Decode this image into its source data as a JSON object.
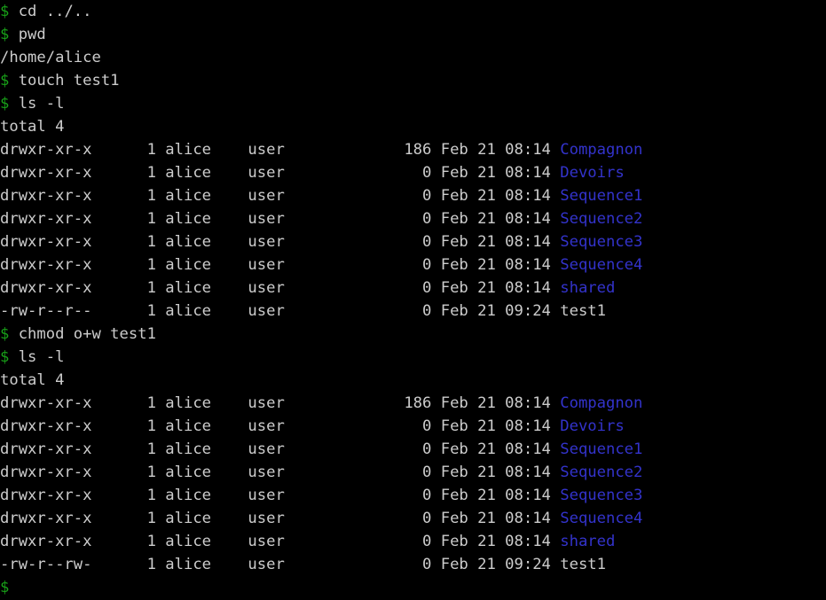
{
  "terminal": {
    "background_color": "#000000",
    "text_color": "#cccccc",
    "prompt_color": "#18a018",
    "directory_color": "#3333cc",
    "prompt_symbol": "$",
    "lines": [
      {
        "kind": "command",
        "prompt": "$",
        "text": " cd ../.."
      },
      {
        "kind": "command",
        "prompt": "$",
        "text": " pwd"
      },
      {
        "kind": "output",
        "text": "/home/alice"
      },
      {
        "kind": "command",
        "prompt": "$",
        "text": " touch test1"
      },
      {
        "kind": "command",
        "prompt": "$",
        "text": " ls -l"
      },
      {
        "kind": "output",
        "text": "total 4"
      },
      {
        "kind": "listing",
        "perms": "drwxr-xr-x",
        "links": "1",
        "owner": "alice",
        "group": "user",
        "size": "186",
        "month": "Feb",
        "day": "21",
        "time": "08:14",
        "name": "Compagnon",
        "nametype": "dir"
      },
      {
        "kind": "listing",
        "perms": "drwxr-xr-x",
        "links": "1",
        "owner": "alice",
        "group": "user",
        "size": "0",
        "month": "Feb",
        "day": "21",
        "time": "08:14",
        "name": "Devoirs",
        "nametype": "dir"
      },
      {
        "kind": "listing",
        "perms": "drwxr-xr-x",
        "links": "1",
        "owner": "alice",
        "group": "user",
        "size": "0",
        "month": "Feb",
        "day": "21",
        "time": "08:14",
        "name": "Sequence1",
        "nametype": "dir"
      },
      {
        "kind": "listing",
        "perms": "drwxr-xr-x",
        "links": "1",
        "owner": "alice",
        "group": "user",
        "size": "0",
        "month": "Feb",
        "day": "21",
        "time": "08:14",
        "name": "Sequence2",
        "nametype": "dir"
      },
      {
        "kind": "listing",
        "perms": "drwxr-xr-x",
        "links": "1",
        "owner": "alice",
        "group": "user",
        "size": "0",
        "month": "Feb",
        "day": "21",
        "time": "08:14",
        "name": "Sequence3",
        "nametype": "dir"
      },
      {
        "kind": "listing",
        "perms": "drwxr-xr-x",
        "links": "1",
        "owner": "alice",
        "group": "user",
        "size": "0",
        "month": "Feb",
        "day": "21",
        "time": "08:14",
        "name": "Sequence4",
        "nametype": "dir"
      },
      {
        "kind": "listing",
        "perms": "drwxr-xr-x",
        "links": "1",
        "owner": "alice",
        "group": "user",
        "size": "0",
        "month": "Feb",
        "day": "21",
        "time": "08:14",
        "name": "shared",
        "nametype": "dir"
      },
      {
        "kind": "listing",
        "perms": "-rw-r--r--",
        "links": "1",
        "owner": "alice",
        "group": "user",
        "size": "0",
        "month": "Feb",
        "day": "21",
        "time": "09:24",
        "name": "test1",
        "nametype": "file"
      },
      {
        "kind": "command",
        "prompt": "$",
        "text": " chmod o+w test1"
      },
      {
        "kind": "command",
        "prompt": "$",
        "text": " ls -l"
      },
      {
        "kind": "output",
        "text": "total 4"
      },
      {
        "kind": "listing",
        "perms": "drwxr-xr-x",
        "links": "1",
        "owner": "alice",
        "group": "user",
        "size": "186",
        "month": "Feb",
        "day": "21",
        "time": "08:14",
        "name": "Compagnon",
        "nametype": "dir"
      },
      {
        "kind": "listing",
        "perms": "drwxr-xr-x",
        "links": "1",
        "owner": "alice",
        "group": "user",
        "size": "0",
        "month": "Feb",
        "day": "21",
        "time": "08:14",
        "name": "Devoirs",
        "nametype": "dir"
      },
      {
        "kind": "listing",
        "perms": "drwxr-xr-x",
        "links": "1",
        "owner": "alice",
        "group": "user",
        "size": "0",
        "month": "Feb",
        "day": "21",
        "time": "08:14",
        "name": "Sequence1",
        "nametype": "dir"
      },
      {
        "kind": "listing",
        "perms": "drwxr-xr-x",
        "links": "1",
        "owner": "alice",
        "group": "user",
        "size": "0",
        "month": "Feb",
        "day": "21",
        "time": "08:14",
        "name": "Sequence2",
        "nametype": "dir"
      },
      {
        "kind": "listing",
        "perms": "drwxr-xr-x",
        "links": "1",
        "owner": "alice",
        "group": "user",
        "size": "0",
        "month": "Feb",
        "day": "21",
        "time": "08:14",
        "name": "Sequence3",
        "nametype": "dir"
      },
      {
        "kind": "listing",
        "perms": "drwxr-xr-x",
        "links": "1",
        "owner": "alice",
        "group": "user",
        "size": "0",
        "month": "Feb",
        "day": "21",
        "time": "08:14",
        "name": "Sequence4",
        "nametype": "dir"
      },
      {
        "kind": "listing",
        "perms": "drwxr-xr-x",
        "links": "1",
        "owner": "alice",
        "group": "user",
        "size": "0",
        "month": "Feb",
        "day": "21",
        "time": "08:14",
        "name": "shared",
        "nametype": "dir"
      },
      {
        "kind": "listing",
        "perms": "-rw-r--rw-",
        "links": "1",
        "owner": "alice",
        "group": "user",
        "size": "0",
        "month": "Feb",
        "day": "21",
        "time": "09:24",
        "name": "test1",
        "nametype": "file"
      },
      {
        "kind": "command",
        "prompt": "$",
        "text": ""
      }
    ]
  }
}
